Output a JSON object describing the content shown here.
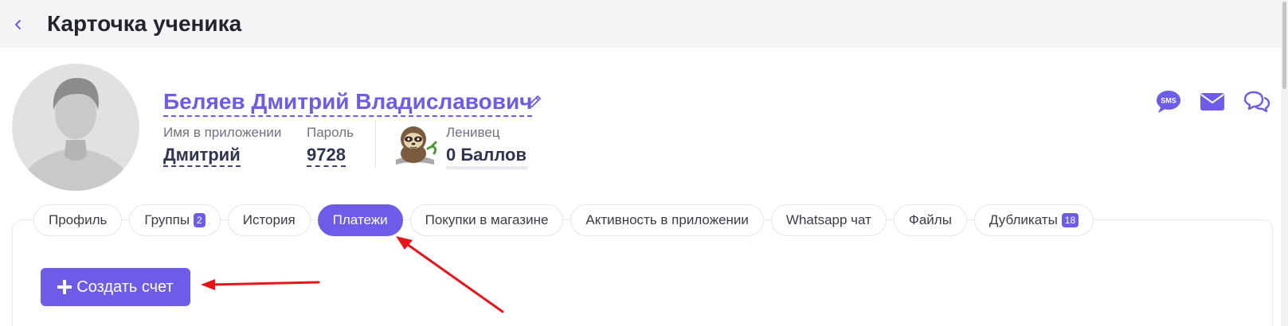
{
  "header": {
    "title": "Карточка ученика"
  },
  "student": {
    "full_name": "Беляев Дмитрий Владиславович",
    "app_name_label": "Имя в приложении",
    "app_name_value": "Дмитрий",
    "password_label": "Пароль",
    "password_value": "9728",
    "level_label": "Ленивец",
    "points_value": "0 Баллов"
  },
  "contacts": {
    "sms_icon_text": "SMS"
  },
  "tabs": [
    {
      "label": "Профиль"
    },
    {
      "label": "Группы",
      "badge": "2"
    },
    {
      "label": "История"
    },
    {
      "label": "Платежи"
    },
    {
      "label": "Покупки в магазине"
    },
    {
      "label": "Активность в приложении"
    },
    {
      "label": "Whatsapp чат"
    },
    {
      "label": "Файлы"
    },
    {
      "label": "Дубликаты",
      "badge": "18"
    }
  ],
  "active_tab": "Платежи",
  "actions": {
    "create_invoice_label": "Создать счет"
  },
  "colors": {
    "accent": "#6c5ce7",
    "annotation_arrow": "#e8141b",
    "text_dark": "#2f3550",
    "header_bg": "#f4f5f7"
  }
}
